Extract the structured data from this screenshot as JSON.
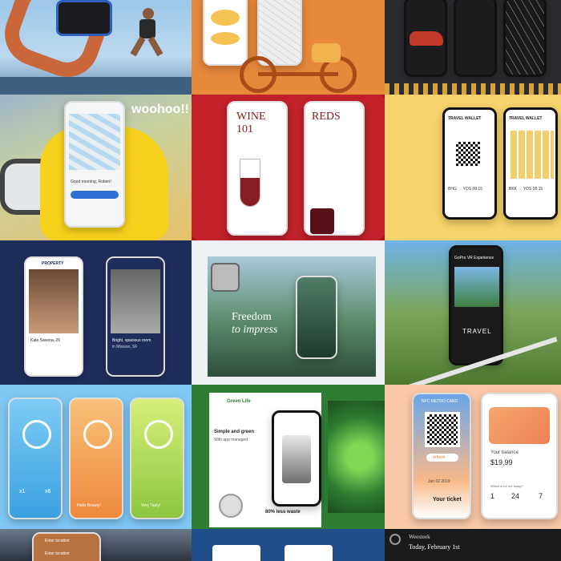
{
  "colors": {
    "tile_orange": "#ec8b3a",
    "tile_dark": "#2b2b2f",
    "wine_red": "#b3121f",
    "travel_yellow": "#f7d36b",
    "navy": "#1f2d5a",
    "sky_blue": "#7fc8f5",
    "green": "#2f7d32",
    "peach": "#f8c8a8"
  },
  "tiles": {
    "fitness": {
      "icon": "fitness-band-icon"
    },
    "bike_map": {
      "icon": "bicycle-icon"
    },
    "dark_map": {
      "icon": "car-icon"
    },
    "woohoo": {
      "caption": "woohoo!!",
      "card_title": "Good morning, Robert!"
    },
    "wine": {
      "left_title_line1": "WINE",
      "left_title_line2": "101",
      "right_title": "REDS"
    },
    "travel_wallet": {
      "left_header": "TRAVEL WALLET",
      "right_header": "TRAVEL WALLET",
      "left_row": "BHG → YOS 08:15",
      "right_row": "BKK → YOS 08:15"
    },
    "property": {
      "left_header": "PROPERTY",
      "left_name": "Kate Saxena, 26",
      "right_title": "Bright, spacious room",
      "right_subtitle": "in Mission, SF"
    },
    "freedom": {
      "headline_line1": "Freedom",
      "headline_line2": "to impress"
    },
    "vr_travel": {
      "header": "GoPro VR Experience",
      "banner": "TRAVEL"
    },
    "water": {
      "values": [
        "x1",
        "x6"
      ],
      "caption_middle": "Hello Beauty!",
      "caption_right": "Very Tasty!"
    },
    "green_life": {
      "brand": "Green Life",
      "headline": "Simple and green",
      "subline": "With app managed",
      "stat": "80% less waste"
    },
    "nfc": {
      "header": "NFC METRO CARD",
      "refresh": "refresh",
      "date": "Jan 02 2019",
      "ticket": "Your ticket",
      "balance_label": "Your balance",
      "balance": "$19,99",
      "counter_label": "Which is for me today?",
      "counter_values": [
        "1",
        "24",
        "7"
      ]
    },
    "bottom_left": {
      "field1": "Enter location",
      "field2": "Enter location"
    },
    "bottom_middle": {},
    "bottom_right": {
      "title": "Weesteek",
      "subtitle": "Today, February 1st"
    }
  }
}
